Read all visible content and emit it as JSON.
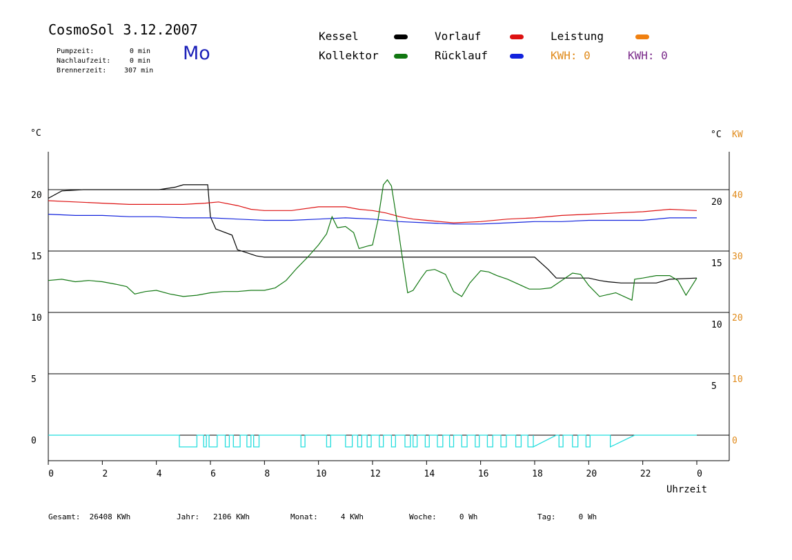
{
  "header": {
    "title": "CosmoSol 3.12.2007",
    "day": "Mo",
    "stats": [
      {
        "label": "Pumpzeit:",
        "value": "0 min"
      },
      {
        "label": "Nachlaufzeit:",
        "value": "0 min"
      },
      {
        "label": "Brennerzeit:",
        "value": "307 min"
      }
    ]
  },
  "legend": {
    "kessel": {
      "label": "Kessel",
      "color": "#000000"
    },
    "vorlauf": {
      "label": "Vorlauf",
      "color": "#dd1111"
    },
    "leistung": {
      "label": "Leistung",
      "color": "#f08010"
    },
    "kollektor": {
      "label": "Kollektor",
      "color": "#117711"
    },
    "ruecklauf": {
      "label": "Rücklauf",
      "color": "#1122dd"
    },
    "kwh_orange": "KWH: 0",
    "kwh_purple": "KWH: 0"
  },
  "footer": {
    "gesamt": "Gesamt:  26408 KWh",
    "jahr": "Jahr:   2106 KWh",
    "monat": "Monat:     4 KWh",
    "woche": "Woche:     0 Wh",
    "tag": "Tag:     0 Wh"
  },
  "chart_data": {
    "type": "line",
    "xlabel": "Uhrzeit",
    "left_unit": "°C",
    "right_unit_temp": "°C",
    "right_unit_power": "KW",
    "xlim": [
      0,
      24
    ],
    "ylim": [
      -2,
      24
    ],
    "x_ticks": [
      "0",
      "2",
      "4",
      "6",
      "8",
      "10",
      "12",
      "14",
      "16",
      "18",
      "20",
      "22",
      "0"
    ],
    "y_left_ticks": [
      0,
      5,
      10,
      15,
      20
    ],
    "y_right_temp_ticks": [
      5,
      10,
      15,
      20
    ],
    "y_right_kw_ticks": [
      0,
      10,
      20,
      30,
      40
    ],
    "series": [
      {
        "name": "Kessel",
        "color": "#000000",
        "x": [
          0,
          0.5,
          1.3,
          4.1,
          4.7,
          5.0,
          5.9,
          6.0,
          6.2,
          6.8,
          7.0,
          7.3,
          7.7,
          8.0,
          8.5,
          12.0,
          18.0,
          18.5,
          18.8,
          19.2,
          19.6,
          20.0,
          20.4,
          20.7,
          21.2,
          21.7,
          22.5,
          23.0,
          24.0
        ],
        "y": [
          19.3,
          19.9,
          20.0,
          20.0,
          20.2,
          20.4,
          20.4,
          17.8,
          16.8,
          16.3,
          15.1,
          14.9,
          14.6,
          14.5,
          14.5,
          14.5,
          14.5,
          13.5,
          12.8,
          12.8,
          12.8,
          12.8,
          12.6,
          12.5,
          12.4,
          12.4,
          12.4,
          12.7,
          12.8
        ]
      },
      {
        "name": "Vorlauf",
        "color": "#dd1111",
        "x": [
          0,
          1,
          2,
          3,
          4,
          5,
          5.8,
          6.3,
          7,
          7.5,
          8,
          9,
          10,
          11,
          11.5,
          12,
          12.5,
          13,
          13.5,
          14,
          14.5,
          15,
          16,
          17,
          18,
          19,
          20,
          21,
          22,
          23,
          24
        ],
        "y": [
          19.1,
          19.0,
          18.9,
          18.8,
          18.8,
          18.8,
          18.9,
          19.0,
          18.7,
          18.4,
          18.3,
          18.3,
          18.6,
          18.6,
          18.4,
          18.3,
          18.1,
          17.8,
          17.6,
          17.5,
          17.4,
          17.3,
          17.4,
          17.6,
          17.7,
          17.9,
          18.0,
          18.1,
          18.2,
          18.4,
          18.3
        ]
      },
      {
        "name": "Rücklauf",
        "color": "#1122dd",
        "x": [
          0,
          1,
          2,
          3,
          4,
          5,
          6,
          7,
          8,
          9,
          10,
          11,
          12,
          13,
          14,
          15,
          16,
          17,
          18,
          19,
          20,
          21,
          22,
          23,
          24
        ],
        "y": [
          18.0,
          17.9,
          17.9,
          17.8,
          17.8,
          17.7,
          17.7,
          17.6,
          17.5,
          17.5,
          17.6,
          17.7,
          17.6,
          17.4,
          17.3,
          17.2,
          17.2,
          17.3,
          17.4,
          17.4,
          17.5,
          17.5,
          17.5,
          17.7,
          17.7
        ]
      },
      {
        "name": "Kollektor",
        "color": "#117711",
        "x": [
          0,
          0.5,
          1,
          1.5,
          2,
          2.5,
          2.9,
          3.2,
          3.6,
          4.0,
          4.5,
          5.0,
          5.5,
          6.0,
          6.5,
          7.0,
          7.5,
          8.0,
          8.4,
          8.8,
          9.2,
          9.6,
          10.0,
          10.3,
          10.5,
          10.7,
          11.0,
          11.3,
          11.5,
          11.8,
          12.0,
          12.2,
          12.4,
          12.55,
          12.7,
          12.9,
          13.1,
          13.3,
          13.5,
          13.8,
          14.0,
          14.3,
          14.7,
          15.0,
          15.3,
          15.6,
          16.0,
          16.3,
          16.6,
          17.0,
          17.4,
          17.8,
          18.2,
          18.6,
          19.0,
          19.4,
          19.7,
          20.0,
          20.4,
          20.8,
          21.0,
          21.6,
          21.7,
          22.0,
          22.5,
          23.0,
          23.3,
          23.6,
          24.0
        ],
        "y": [
          12.6,
          12.7,
          12.5,
          12.6,
          12.5,
          12.3,
          12.1,
          11.5,
          11.7,
          11.8,
          11.5,
          11.3,
          11.4,
          11.6,
          11.7,
          11.7,
          11.8,
          11.8,
          12.0,
          12.6,
          13.6,
          14.5,
          15.5,
          16.4,
          17.8,
          16.9,
          17.0,
          16.5,
          15.2,
          15.4,
          15.5,
          17.5,
          20.4,
          20.8,
          20.3,
          17.5,
          14.5,
          11.6,
          11.8,
          12.8,
          13.4,
          13.5,
          13.1,
          11.7,
          11.3,
          12.4,
          13.4,
          13.3,
          13.0,
          12.7,
          12.3,
          11.9,
          11.9,
          12.0,
          12.6,
          13.2,
          13.1,
          12.2,
          11.3,
          11.5,
          11.6,
          11.0,
          12.7,
          12.8,
          13.0,
          13.0,
          12.6,
          11.4,
          12.8
        ]
      }
    ],
    "pump_pulses": [
      [
        4.85,
        5.5
      ],
      [
        5.75,
        5.85
      ],
      [
        5.95,
        6.25
      ],
      [
        6.55,
        6.7
      ],
      [
        6.85,
        7.1
      ],
      [
        7.35,
        7.5
      ],
      [
        7.6,
        7.8
      ],
      [
        9.35,
        9.5
      ],
      [
        10.3,
        10.45
      ],
      [
        11.0,
        11.25
      ],
      [
        11.45,
        11.6
      ],
      [
        11.8,
        11.95
      ],
      [
        12.25,
        12.4
      ],
      [
        12.7,
        12.85
      ],
      [
        13.2,
        13.4
      ],
      [
        13.5,
        13.65
      ],
      [
        13.95,
        14.1
      ],
      [
        14.4,
        14.6
      ],
      [
        14.85,
        15.0
      ],
      [
        15.3,
        15.5
      ],
      [
        15.8,
        15.95
      ],
      [
        16.25,
        16.45
      ],
      [
        16.75,
        16.95
      ],
      [
        17.3,
        17.5
      ],
      [
        17.75,
        17.95
      ]
    ],
    "pump_ramps": [
      [
        17.95,
        18.8
      ],
      [
        20.8,
        21.7
      ]
    ],
    "pump_tail": [
      [
        18.9,
        19.05
      ],
      [
        19.4,
        19.6
      ],
      [
        19.9,
        20.05
      ]
    ],
    "grid": true
  }
}
